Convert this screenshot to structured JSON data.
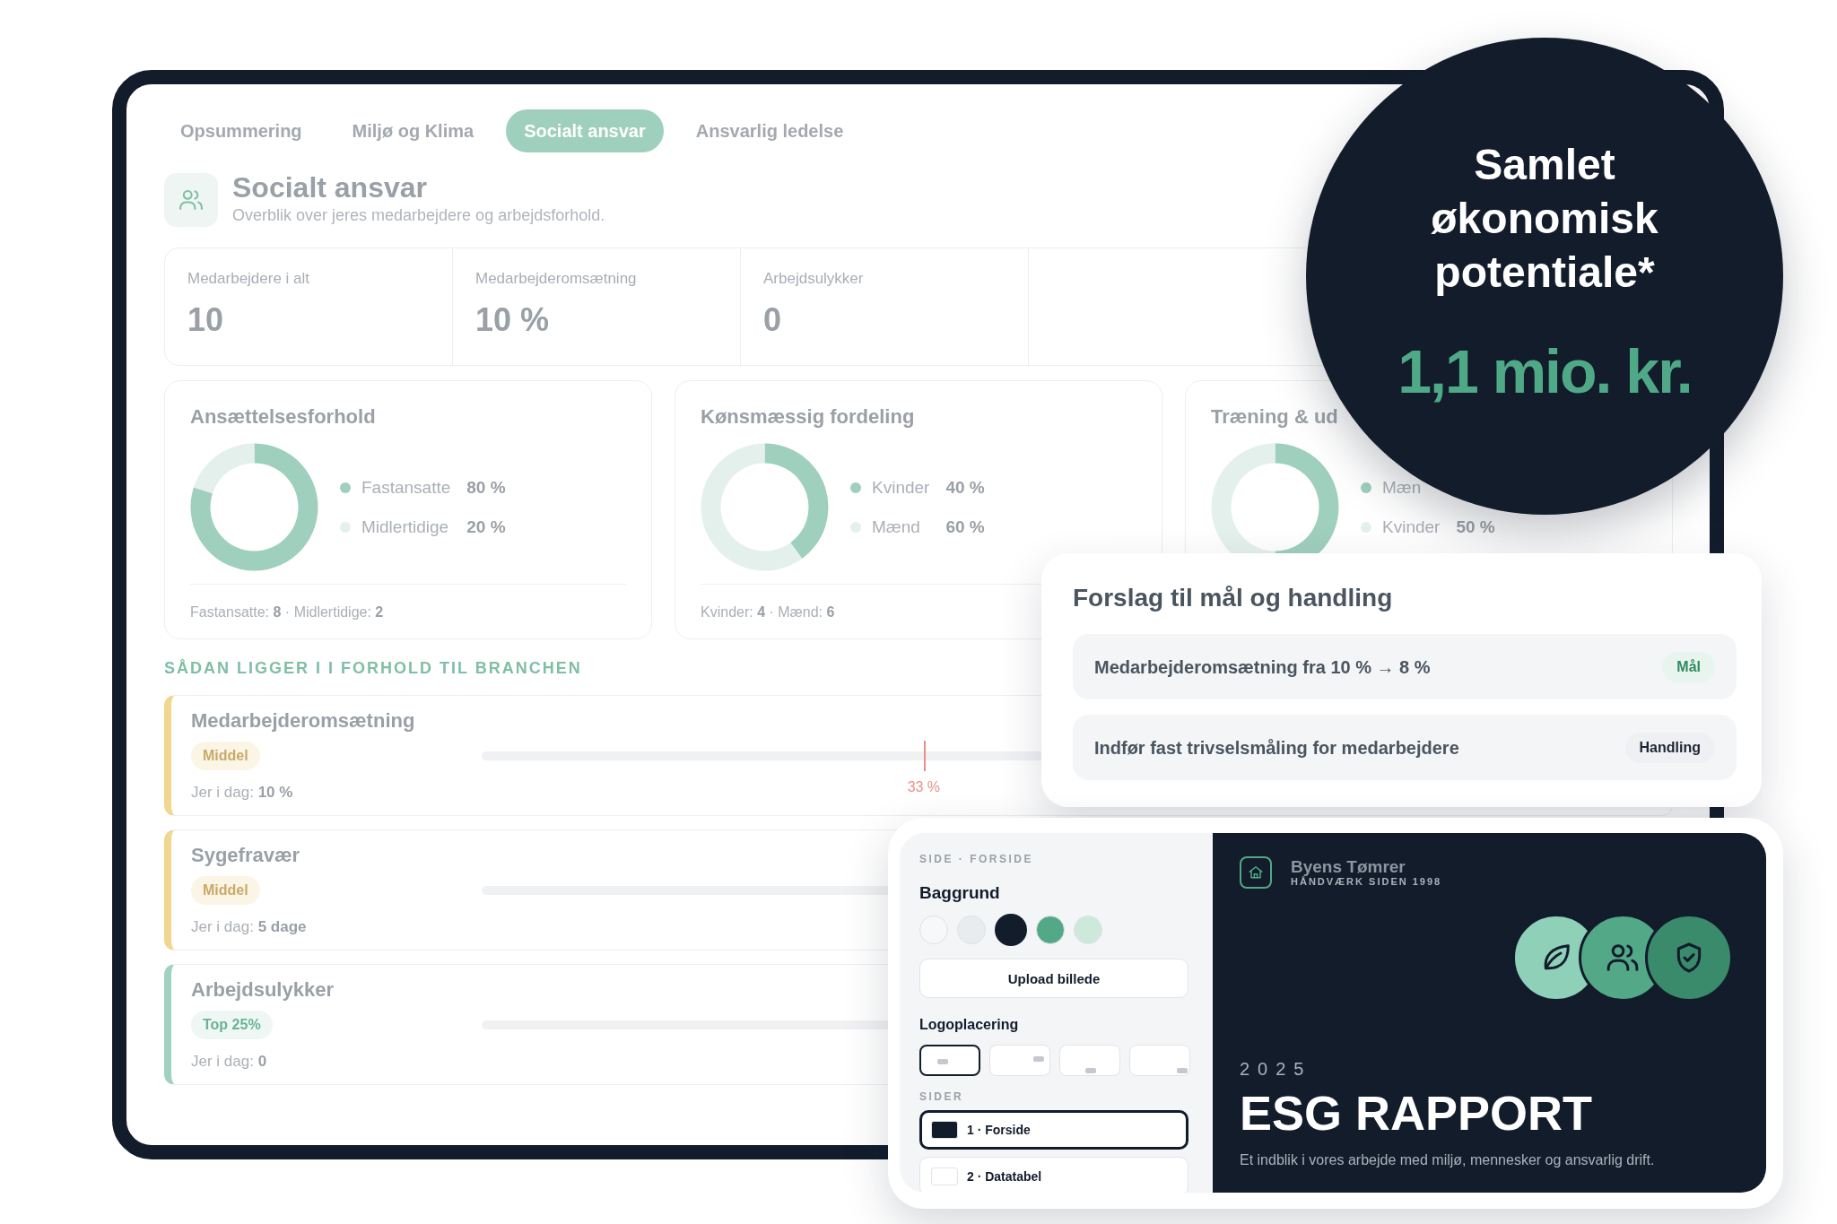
{
  "tabs": [
    {
      "label": "Opsummering",
      "selected": false
    },
    {
      "label": "Miljø og Klima",
      "selected": false
    },
    {
      "label": "Socialt ansvar",
      "selected": true
    },
    {
      "label": "Ansvarlig ledelse",
      "selected": false
    }
  ],
  "header": {
    "title": "Socialt ansvar",
    "subtitle": "Overblik over jeres medarbejdere og arbejdsforhold."
  },
  "stats": [
    {
      "label": "Medarbejdere i alt",
      "value": "10"
    },
    {
      "label": "Medarbejderomsætning",
      "value": "10 %"
    },
    {
      "label": "Arbejdsulykker",
      "value": "0"
    }
  ],
  "distribution_cards": [
    {
      "title": "Ansættelsesforhold",
      "legend": [
        {
          "value": "80 %",
          "color": "#9fcfbd"
        },
        {
          "value": "20 %",
          "color": "#e4f0eb"
        }
      ],
      "footer": "Fastansatte: **8** · Midlertidige: **2**",
      "chart_data": {
        "type": "donut",
        "categories": [
          "Fastansatte",
          "Midlertidige"
        ],
        "values": [
          80,
          20
        ],
        "legend": "right"
      }
    },
    {
      "title": "Kønsmæssig fordeling",
      "legend": [
        {
          "value": "40 %",
          "color": "#9fcfbd"
        },
        {
          "value": "60 %",
          "color": "#e4f0eb"
        }
      ],
      "footer": "Kvinder: **4** · Mænd: **6**",
      "chart_data": {
        "type": "donut",
        "categories": [
          "Kvinder",
          "Mænd"
        ],
        "values": [
          40,
          60
        ],
        "legend": "right"
      }
    },
    {
      "title": "Træning & ud",
      "legend": [
        {
          "color": "#9fcfbd"
        },
        {
          "value": "50 %",
          "color": "#e4f0eb"
        }
      ],
      "chart_data": {
        "type": "donut",
        "categories": [
          "Mæn",
          "Kvinder"
        ],
        "values": [
          50,
          50
        ],
        "legend": "right"
      }
    }
  ],
  "benchmark": {
    "heading": "SÅDAN LIGGER I I FORHOLD TIL BRANCHEN",
    "rows": [
      {
        "title": "Medarbejderomsætning",
        "badge": {
          "label": "Middel",
          "kind": "average"
        },
        "current": "Jer i dag: **10 %**",
        "marker": {
          "label": "33 %",
          "level": 0.38
        }
      },
      {
        "title": "Sygefravær",
        "badge": {
          "label": "Middel",
          "kind": "average"
        },
        "current": "Jer i dag: **5 dage**"
      },
      {
        "title": "Arbejdsulykker",
        "badge": {
          "label": "Top 25%",
          "kind": "top"
        },
        "current": "Jer i dag: **0**"
      }
    ]
  },
  "savings": {
    "title": "Samlet økonomisk potentiale*",
    "value": "1,1 mio. kr."
  },
  "suggestions": {
    "title": "Forslag til mål og handling",
    "items": [
      {
        "text": "Medarbejderomsætning fra 10 % → 8 %",
        "tag": "Mål",
        "kind": "goal"
      },
      {
        "text": "Indfør fast trivselsmåling for medarbejdere",
        "tag": "Handling",
        "kind": "action"
      }
    ]
  },
  "editor": {
    "section_label": "SIDE · FORSIDE",
    "background_label": "Baggrund",
    "swatches": [
      {
        "color": "#f7f8f9",
        "selected": false
      },
      {
        "color": "#e9ecef",
        "selected": false
      },
      {
        "color": "#121c2b",
        "selected": true
      },
      {
        "color": "#52a887",
        "selected": false
      },
      {
        "color": "#cde9dc",
        "selected": false
      }
    ],
    "upload_button": "Upload billede",
    "logo_label": "Logoplacering",
    "logo_options": [
      {
        "kind": "top-left",
        "selected": true
      },
      {
        "kind": "top-right",
        "selected": false
      },
      {
        "kind": "bottom-center",
        "selected": false
      },
      {
        "kind": "bottom-right",
        "selected": false
      }
    ],
    "pages_label": "SIDER",
    "pages": [
      {
        "label": "1 · Forside",
        "color": "#121c2b",
        "selected": true
      },
      {
        "label": "2 · Datatabel",
        "color": "#ffffff",
        "selected": false
      }
    ]
  },
  "preview": {
    "company": "Byens Tømrer",
    "tagline": "HÅNDVÆRK SIDEN 1998",
    "badges": [
      {
        "kind": "leaf",
        "color": "#8fd0b8"
      },
      {
        "kind": "people",
        "color": "#52a887"
      },
      {
        "kind": "shield",
        "color": "#3a8a6c"
      }
    ],
    "year": "2025",
    "title": "ESG RAPPORT",
    "subtitle": "Et indblik i vores arbejde med miljø, mennesker og ansvarlig drift."
  }
}
